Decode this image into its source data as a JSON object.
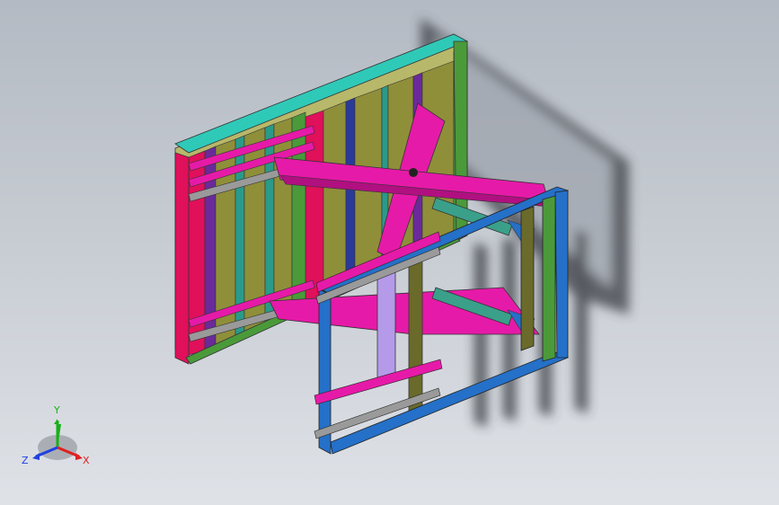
{
  "viewport": {
    "background_top": "#b4bac3",
    "background_bottom": "#dfe2e7"
  },
  "triad": {
    "x_label": "X",
    "y_label": "Y",
    "z_label": "Z",
    "x_color": "#e02020",
    "y_color": "#18b018",
    "z_color": "#2040e0"
  },
  "model": {
    "colors": {
      "rear_frame": "#e0105a",
      "top_rail": "#2fc9b8",
      "slats_olive": "#8f8f3a",
      "slats_purple": "#6a2a9a",
      "slats_teal": "#2a9a8a",
      "magenta_parts": "#e61aa8",
      "front_frame": "#2570c8",
      "green_posts": "#4a9a3a",
      "cylinder": "#3aa08a",
      "lavender": "#b49ae8",
      "olive_post": "#6a6a2a",
      "shadow": "#2f3338"
    }
  }
}
